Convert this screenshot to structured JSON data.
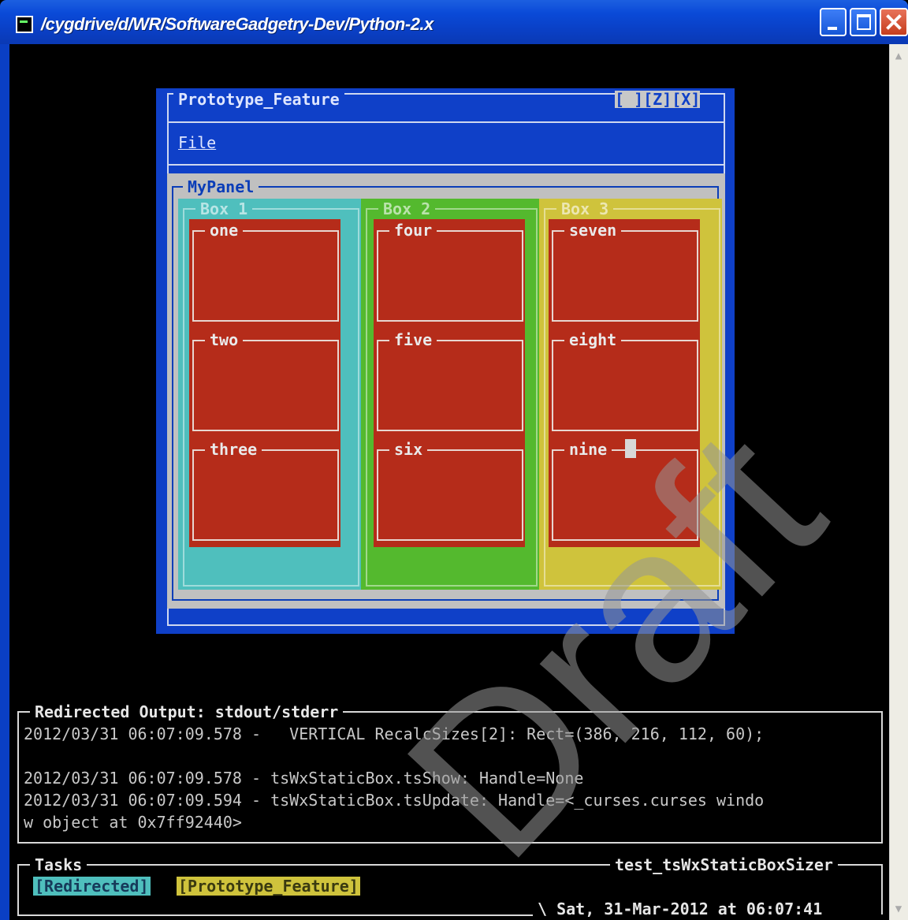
{
  "window": {
    "title": "/cygdrive/d/WR/SoftwareGadgetry-Dev/Python-2.x"
  },
  "frame": {
    "title": "Prototype_Feature",
    "buttons": "[ ][Z][X]",
    "menu_file": "File"
  },
  "panel": {
    "title": "MyPanel",
    "boxes": [
      {
        "title": "Box 1",
        "color": "#4fbfbd",
        "items": [
          "one",
          "two",
          "three"
        ]
      },
      {
        "title": "Box 2",
        "color": "#54b92e",
        "items": [
          "four",
          "five",
          "six"
        ]
      },
      {
        "title": "Box 3",
        "color": "#cfc33c",
        "items": [
          "seven",
          "eight",
          "nine"
        ]
      }
    ],
    "cell_color": "#b52c1a"
  },
  "output": {
    "title": "Redirected Output: stdout/stderr",
    "lines": [
      "2012/03/31 06:07:09.578 -   VERTICAL RecalcSizes[2]: Rect=(386, 216, 112, 60);",
      "",
      "2012/03/31 06:07:09.578 - tsWxStaticBox.tsShow: Handle=None",
      "2012/03/31 06:07:09.594 - tsWxStaticBox.tsUpdate: Handle=<_curses.curses windo",
      "w object at 0x7ff92440>"
    ]
  },
  "tasks": {
    "title": "Tasks",
    "app_name": "test_tsWxStaticBoxSizer",
    "items": [
      "[Redirected]",
      "[Prototype_Feature]"
    ],
    "clock": "\\ Sat, 31-Mar-2012 at 06:07:41"
  },
  "watermark": "Draft"
}
